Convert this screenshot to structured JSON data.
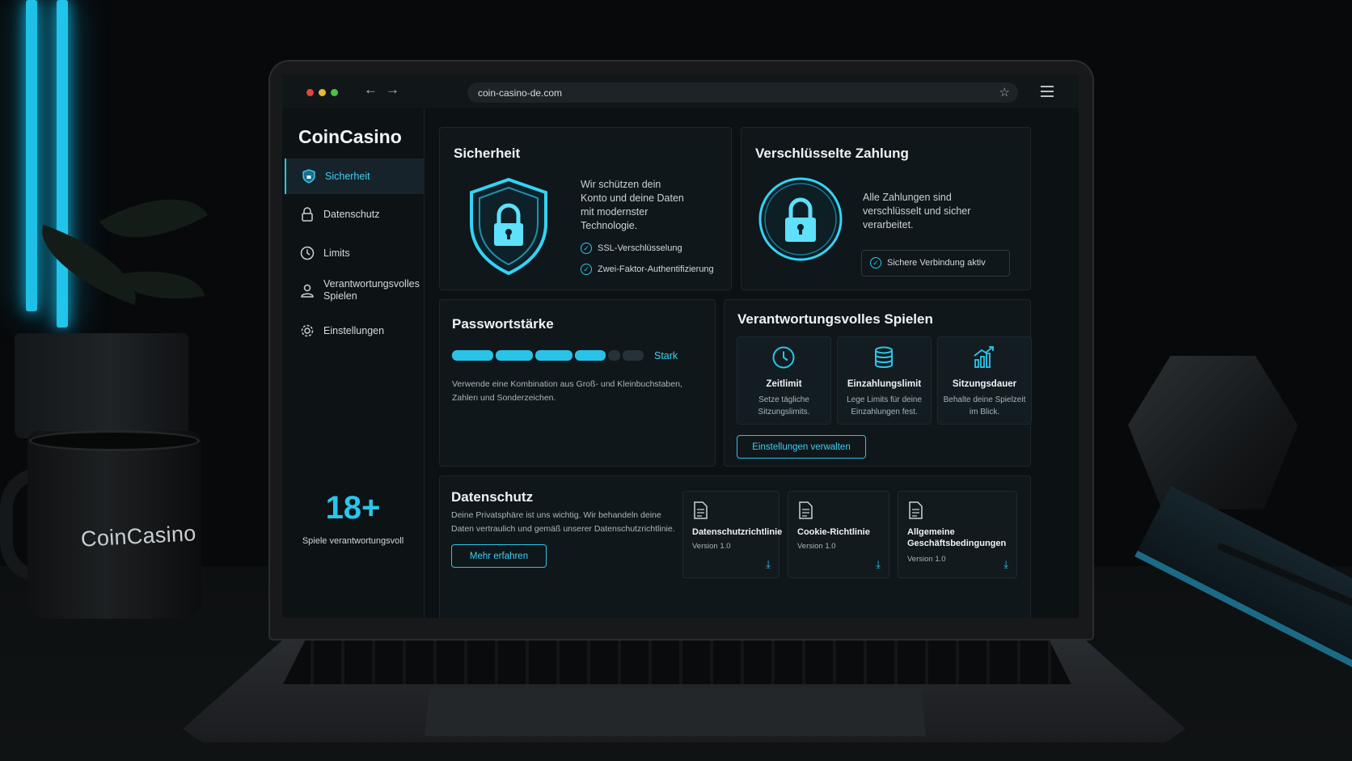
{
  "colors": {
    "accent": "#26c5eb",
    "panel": "#10171b",
    "background": "#0c1114"
  },
  "mug_logo": "CoinCasino",
  "browser": {
    "url": "coin-casino-de.com",
    "icons": [
      "back-arrow-icon",
      "forward-arrow-icon",
      "star-icon",
      "hamburger-menu-icon"
    ]
  },
  "sidebar": {
    "brand": "CoinCasino",
    "items": [
      {
        "label": "Sicherheit",
        "icon": "shield-icon",
        "active": true
      },
      {
        "label": "Datenschutz",
        "icon": "lock-icon",
        "active": false
      },
      {
        "label": "Limits",
        "icon": "clock-icon",
        "active": false
      },
      {
        "label": "Verantwortungsvolles Spielen",
        "icon": "user-icon",
        "active": false
      },
      {
        "label": "Einstellungen",
        "icon": "gear-icon",
        "active": false
      }
    ],
    "age_badge": "18+",
    "age_text": "Spiele verantwortungsvoll"
  },
  "security": {
    "title": "Sicherheit",
    "description": "Wir schützen dein Konto und deine Daten mit modernster Technologie.",
    "checks": [
      "SSL-Verschlüsselung",
      "Zwei-Faktor-Authentifizierung"
    ]
  },
  "payment": {
    "title": "Verschlüsselte Zahlung",
    "description": "Alle Zahlungen sind verschlüsselt und sicher verarbeitet.",
    "status": "Sichere Verbindung aktiv"
  },
  "password": {
    "title": "Passwortstärke",
    "strength_label": "Stark",
    "filled_segments": 4,
    "total_segments": 6,
    "hint": "Verwende eine Kombination aus Groß- und Kleinbuchstaben, Zahlen und Sonderzeichen."
  },
  "responsible": {
    "title": "Verantwortungsvolles Spielen",
    "features": [
      {
        "title": "Zeitlimit",
        "text": "Setze tägliche Sitzungslimits.",
        "icon": "clock-icon"
      },
      {
        "title": "Einzahlungslimit",
        "text": "Lege Limits für deine Einzahlungen fest.",
        "icon": "coin-stack-icon"
      },
      {
        "title": "Sitzungsdauer",
        "text": "Behalte deine Spielzeit im Blick.",
        "icon": "chart-icon"
      }
    ],
    "button": "Einstellungen verwalten"
  },
  "privacy": {
    "title": "Datenschutz",
    "description": "Deine Privatsphäre ist uns wichtig. Wir behandeln deine Daten vertraulich und gemäß unserer Datenschutzrichtlinie.",
    "button": "Mehr erfahren",
    "documents": [
      {
        "title": "Datenschutzrichtlinie",
        "version": "Version 1.0"
      },
      {
        "title": "Cookie-Richtlinie",
        "version": "Version 1.0"
      },
      {
        "title": "Allgemeine Geschäftsbedingungen",
        "version": "Version 1.0"
      }
    ]
  }
}
